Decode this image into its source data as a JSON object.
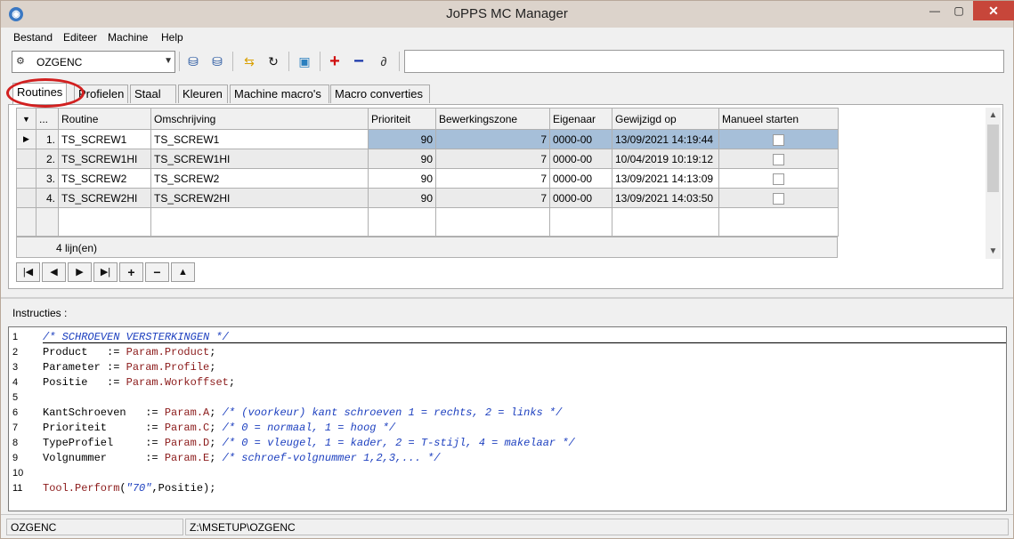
{
  "window": {
    "title": "JoPPS MC Manager"
  },
  "menu": [
    "Bestand",
    "Editeer",
    "Machine",
    "Help"
  ],
  "toolbar": {
    "machine": "OZGENC",
    "command_value": ""
  },
  "tabs": [
    "Routines",
    "Profielen",
    "Staal",
    "Kleuren",
    "Machine macro's",
    "Macro converties"
  ],
  "grid": {
    "columns": [
      "...",
      "Routine",
      "Omschrijving",
      "Prioriteit",
      "Bewerkingszone",
      "Eigenaar",
      "Gewijzigd op",
      "Manueel starten"
    ],
    "rows": [
      {
        "no": "1.",
        "routine": "TS_SCREW1",
        "desc": "TS_SCREW1",
        "prio": "90",
        "zone": "7",
        "owner": "0000-00",
        "modified": "13/09/2021 14:19:44"
      },
      {
        "no": "2.",
        "routine": "TS_SCREW1HI",
        "desc": "TS_SCREW1HI",
        "prio": "90",
        "zone": "7",
        "owner": "0000-00",
        "modified": "10/04/2019 10:19:12"
      },
      {
        "no": "3.",
        "routine": "TS_SCREW2",
        "desc": "TS_SCREW2",
        "prio": "90",
        "zone": "7",
        "owner": "0000-00",
        "modified": "13/09/2021 14:13:09"
      },
      {
        "no": "4.",
        "routine": "TS_SCREW2HI",
        "desc": "TS_SCREW2HI",
        "prio": "90",
        "zone": "7",
        "owner": "0000-00",
        "modified": "13/09/2021 14:03:50"
      }
    ],
    "footer": "4 lijn(en)"
  },
  "instructions_label": "Instructies :",
  "code_lines": [
    {
      "n": "1",
      "parts": [
        [
          "c",
          "/* SCHROEVEN VERSTERKINGEN */"
        ]
      ]
    },
    {
      "n": "2",
      "parts": [
        [
          "t",
          "Product   := "
        ],
        [
          "k",
          "Param.Product"
        ],
        [
          "t",
          ";"
        ]
      ]
    },
    {
      "n": "3",
      "parts": [
        [
          "t",
          "Parameter := "
        ],
        [
          "k",
          "Param.Profile"
        ],
        [
          "t",
          ";"
        ]
      ]
    },
    {
      "n": "4",
      "parts": [
        [
          "t",
          "Positie   := "
        ],
        [
          "k",
          "Param.Workoffset"
        ],
        [
          "t",
          ";"
        ]
      ]
    },
    {
      "n": "5",
      "parts": []
    },
    {
      "n": "6",
      "parts": [
        [
          "t",
          "KantSchroeven   := "
        ],
        [
          "k",
          "Param.A"
        ],
        [
          "t",
          "; "
        ],
        [
          "c",
          "/* (voorkeur) kant schroeven 1 = rechts, 2 = links */"
        ]
      ]
    },
    {
      "n": "7",
      "parts": [
        [
          "t",
          "Prioriteit      := "
        ],
        [
          "k",
          "Param.C"
        ],
        [
          "t",
          "; "
        ],
        [
          "c",
          "/* 0 = normaal, 1 = hoog */"
        ]
      ]
    },
    {
      "n": "8",
      "parts": [
        [
          "t",
          "TypeProfiel     := "
        ],
        [
          "k",
          "Param.D"
        ],
        [
          "t",
          "; "
        ],
        [
          "c",
          "/* 0 = vleugel, 1 = kader, 2 = T-stijl, 4 = makelaar */"
        ]
      ]
    },
    {
      "n": "9",
      "parts": [
        [
          "t",
          "Volgnummer      := "
        ],
        [
          "k",
          "Param.E"
        ],
        [
          "t",
          "; "
        ],
        [
          "c",
          "/* schroef-volgnummer 1,2,3,... */"
        ]
      ]
    },
    {
      "n": "10",
      "parts": []
    },
    {
      "n": "11",
      "parts": [
        [
          "k",
          "Tool.Perform"
        ],
        [
          "t",
          "("
        ],
        [
          "s",
          "\"70\""
        ],
        [
          "t",
          ",Positie);"
        ]
      ]
    }
  ],
  "status": {
    "machine": "OZGENC",
    "path": "Z:\\MSETUP\\OZGENC"
  }
}
